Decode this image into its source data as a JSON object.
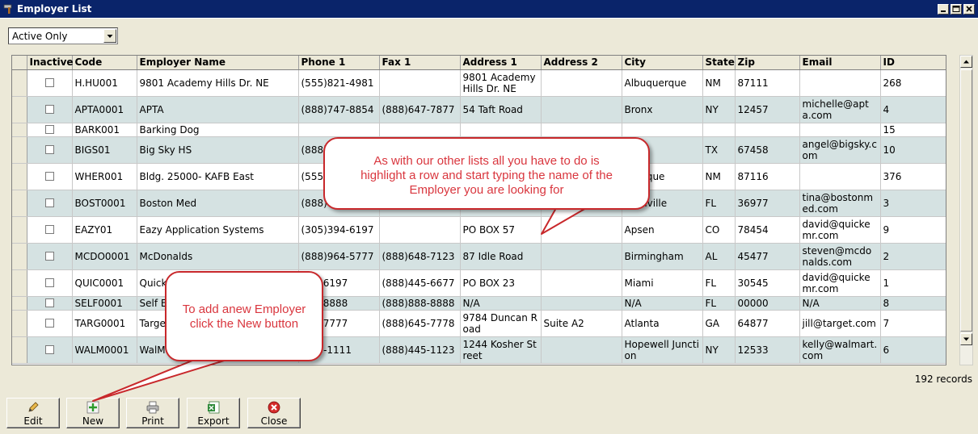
{
  "window": {
    "title": "Employer List"
  },
  "filter": {
    "selected": "Active Only"
  },
  "grid": {
    "columns": [
      "Inactive",
      "Code",
      "Employer Name",
      "Phone 1",
      "Fax 1",
      "Address 1",
      "Address 2",
      "City",
      "State",
      "Zip",
      "Email",
      "ID"
    ],
    "rows": [
      {
        "code": "H.HU001",
        "name": "9801 Academy Hills Dr. NE",
        "phone": "(555)821-4981",
        "fax": "",
        "addr1": "9801 Academy Hills Dr. NE",
        "addr2": "",
        "city": "Albuquerque",
        "state": "NM",
        "zip": "87111",
        "email": "",
        "id": "268"
      },
      {
        "code": "APTA0001",
        "name": "APTA",
        "phone": "(888)747-8854",
        "fax": "(888)647-7877",
        "addr1": "54 Taft Road",
        "addr2": "",
        "city": "Bronx",
        "state": "NY",
        "zip": "12457",
        "email": "michelle@apta.com",
        "id": "4"
      },
      {
        "code": "BARK001",
        "name": "Barking Dog",
        "phone": "",
        "fax": "",
        "addr1": "",
        "addr2": "",
        "city": "",
        "state": "",
        "zip": "",
        "email": "",
        "id": "15"
      },
      {
        "code": "BIGS01",
        "name": "Big Sky HS",
        "phone": "(888)",
        "fax": "",
        "addr1": "",
        "addr2": "",
        "city": "",
        "state": "TX",
        "zip": "67458",
        "email": "angel@bigsky.com",
        "id": "10"
      },
      {
        "code": "WHER001",
        "name": "Bldg. 25000- KAFB East",
        "phone": "(555)",
        "fax": "",
        "addr1": "",
        "addr2": "",
        "city": "querque",
        "state": "NM",
        "zip": "87116",
        "email": "",
        "id": "376"
      },
      {
        "code": "BOST0001",
        "name": "Boston Med",
        "phone": "(888)4",
        "fax": "",
        "addr1": "",
        "addr2": "",
        "city": "ksonville",
        "state": "FL",
        "zip": "36977",
        "email": "tina@bostonmed.com",
        "id": "3"
      },
      {
        "code": "EAZY01",
        "name": "Eazy Application Systems",
        "phone": "(305)394-6197",
        "fax": "",
        "addr1": "PO BOX 57",
        "addr2": "",
        "city": "Apsen",
        "state": "CO",
        "zip": "78454",
        "email": "david@quickemr.com",
        "id": "9"
      },
      {
        "code": "MCDO0001",
        "name": "McDonalds",
        "phone": "(888)964-5777",
        "fax": "(888)648-7123",
        "addr1": "87 Idle Road",
        "addr2": "",
        "city": "Birmingham",
        "state": "AL",
        "zip": "45477",
        "email": "steven@mcdonalds.com",
        "id": "2"
      },
      {
        "code": "QUIC0001",
        "name": "QuickE",
        "phone": "394-6197",
        "fax": "(888)445-6677",
        "addr1": "PO BOX 23",
        "addr2": "",
        "city": "Miami",
        "state": "FL",
        "zip": "30545",
        "email": "david@quickemr.com",
        "id": "1"
      },
      {
        "code": "SELF0001",
        "name": "Self E",
        "phone": "888-8888",
        "fax": "(888)888-8888",
        "addr1": "N/A",
        "addr2": "",
        "city": "N/A",
        "state": "FL",
        "zip": "00000",
        "email": "N/A",
        "id": "8"
      },
      {
        "code": "TARG0001",
        "name": "Targe",
        "phone": "645-7777",
        "fax": "(888)645-7778",
        "addr1": "9784 Duncan Road",
        "addr2": "Suite A2",
        "city": "Atlanta",
        "state": "GA",
        "zip": "64877",
        "email": "jill@target.com",
        "id": "7"
      },
      {
        "code": "WALM0001",
        "name": "WalMa",
        "phone": ")445-1111",
        "fax": "(888)445-1123",
        "addr1": "1244 Kosher Street",
        "addr2": "",
        "city": "Hopewell Junction",
        "state": "NY",
        "zip": "12533",
        "email": "kelly@walmart.com",
        "id": "6"
      }
    ]
  },
  "records_label": "192 records",
  "toolbar": {
    "edit_label": "Edit",
    "new_label": "New",
    "print_label": "Print",
    "export_label": "Export",
    "close_label": "Close"
  },
  "callouts": {
    "top_line1": "As with our other lists all you have to do is",
    "top_line2": "highlight a row and start typing the name of the",
    "top_line3": "Employer you are looking for",
    "bottom_line1": "To add anew Employer",
    "bottom_line2": "click the New button"
  },
  "colors": {
    "titlebar": "#0a246a",
    "alt_row": "#d5e2e2",
    "callout_border": "#c8282b",
    "callout_text": "#d9363e"
  }
}
